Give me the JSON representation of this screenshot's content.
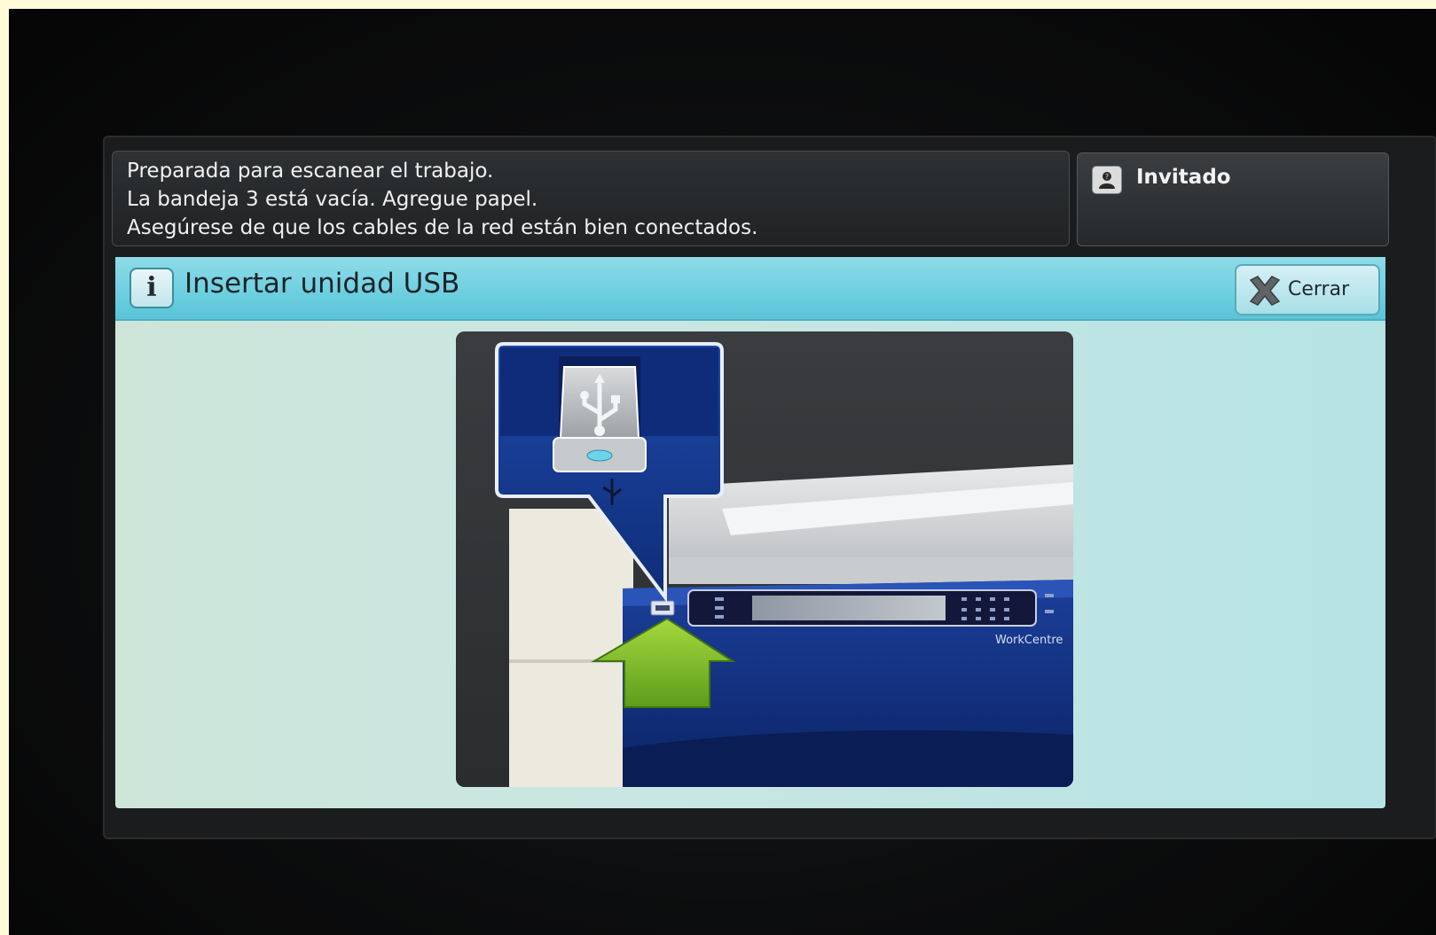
{
  "status": {
    "lines": [
      "Preparada para escanear el trabajo.",
      "La bandeja 3 está vacía. Agregue papel.",
      "Asegúrese de que los cables de la red están bien conectados."
    ]
  },
  "user": {
    "icon": "user-icon",
    "label": "Invitado"
  },
  "dialog": {
    "icon": "info-icon",
    "info_glyph": "i",
    "title": "Insertar unidad USB",
    "close_label": "Cerrar",
    "close_icon": "close-icon"
  },
  "illustration": {
    "brand_text": "WorkCentre",
    "usb_icon": "usb-icon",
    "arrow_icon": "arrow-up-icon"
  }
}
